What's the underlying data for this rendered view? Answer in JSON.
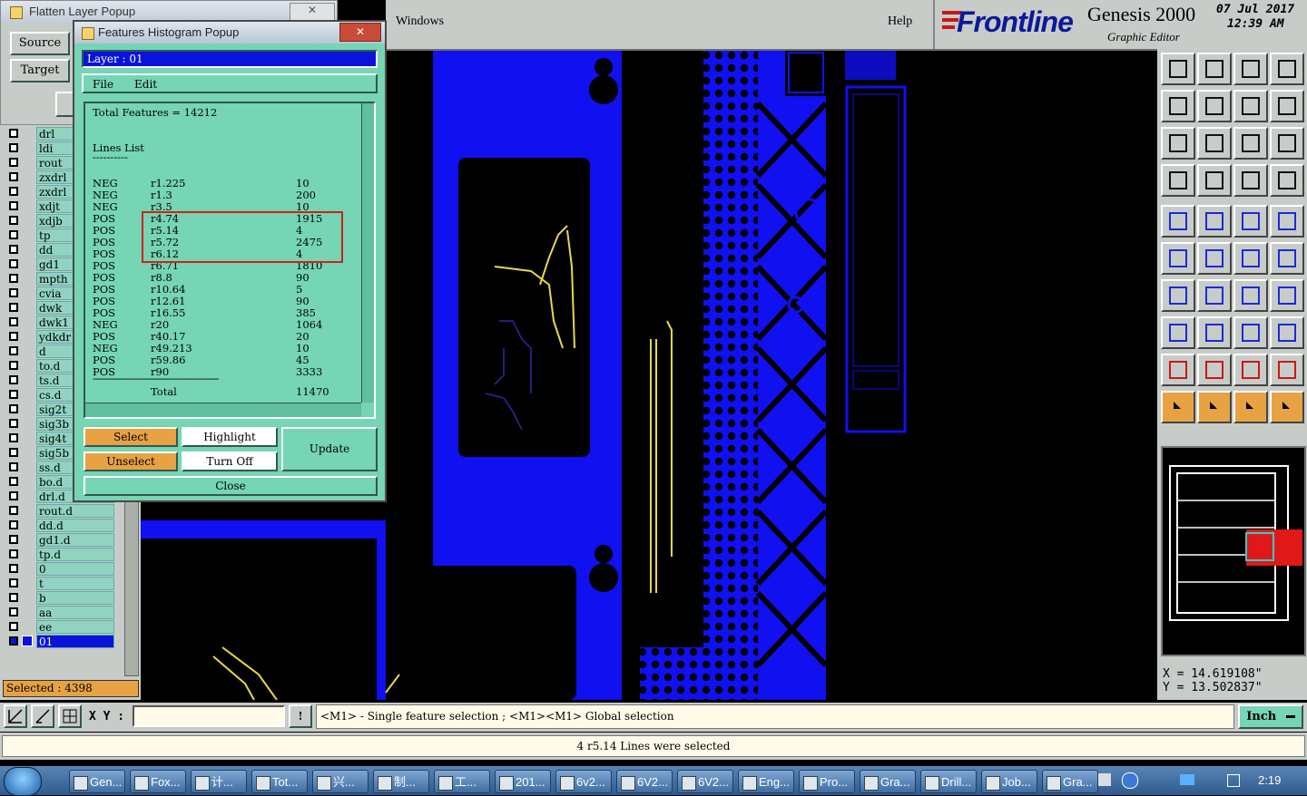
{
  "menubar": {
    "windows": "Windows",
    "help": "Help"
  },
  "brand": {
    "logo": "Frontline",
    "product": "Genesis 2000",
    "subtitle": "Graphic Editor",
    "date": "07 Jul 2017",
    "time": "12:39 AM"
  },
  "flatten_popup": {
    "title": "Flatten Layer Popup",
    "source_label": "Source",
    "target_label": "Target",
    "close_glyph": "✕"
  },
  "layers": [
    "drl",
    "ldi",
    "rout",
    "zxdrl",
    "zxdrl",
    "xdjt",
    "xdjb",
    "tp",
    "dd",
    "gd1",
    "mpth",
    "cvia",
    "dwk",
    "dwk1",
    "ydkdr",
    "d",
    "to.d",
    "ts.d",
    "cs.d",
    "sig2t",
    "sig3b",
    "sig4t",
    "sig5b",
    "ss.d",
    "bo.d",
    "drl.d",
    "rout.d",
    "dd.d",
    "gd1.d",
    "tp.d",
    "0",
    "t",
    "b",
    "aa",
    "ee",
    "01"
  ],
  "selected_count": "Selected : 4398",
  "histogram": {
    "title": "Features Histogram Popup",
    "close_glyph": "✕",
    "layer_label": "Layer :  01",
    "menu": [
      "File",
      "Edit"
    ],
    "total_features": "Total Features = 14212",
    "list_heading": "Lines List",
    "list_underline": "----------",
    "rows": [
      [
        "NEG",
        "r1.225",
        "10"
      ],
      [
        "NEG",
        "r1.3",
        "200"
      ],
      [
        "NEG",
        "r3.5",
        "10"
      ],
      [
        "POS",
        "r4.74",
        "1915"
      ],
      [
        "POS",
        "r5.14",
        "4"
      ],
      [
        "POS",
        "r5.72",
        "2475"
      ],
      [
        "POS",
        "r6.12",
        "4"
      ],
      [
        "POS",
        "r6.71",
        "1810"
      ],
      [
        "POS",
        "r8.8",
        "90"
      ],
      [
        "POS",
        "r10.64",
        "5"
      ],
      [
        "POS",
        "r12.61",
        "90"
      ],
      [
        "POS",
        "r16.55",
        "385"
      ],
      [
        "NEG",
        "r20",
        "1064"
      ],
      [
        "POS",
        "r40.17",
        "20"
      ],
      [
        "NEG",
        "r49.213",
        "10"
      ],
      [
        "POS",
        "r59.86",
        "45"
      ],
      [
        "POS",
        "r90",
        "3333"
      ]
    ],
    "separator": "------------------------------------------------",
    "total_label": "Total",
    "total_value": "11470",
    "buttons": {
      "select": "Select",
      "highlight": "Highlight",
      "update": "Update",
      "unselect": "Unselect",
      "turn_off": "Turn Off",
      "close": "Close"
    }
  },
  "coords": {
    "x": "X  =  14.619108\"",
    "y": "Y  =  13.502837\""
  },
  "xy_label": "X Y :",
  "xy_value": "",
  "hint": "<M1> - Single feature selection ; <M1><M1> Global selection",
  "units": "Inch",
  "status": "4 r5.14 Lines were selected",
  "taskbar": {
    "items": [
      "Gen...",
      "Fox...",
      "计...",
      "Tot...",
      "兴...",
      "制...",
      "工...",
      "201...",
      "6v2...",
      "6V2...",
      "6V2...",
      "Eng...",
      "Pro...",
      "Gra...",
      "Drill...",
      "Job...",
      "Gra..."
    ],
    "clock": "2:19"
  },
  "colors": {
    "canvas_blue": "#1010f0",
    "trace_yellow": "#e8d84a",
    "panel_green": "#75d5b4",
    "accent_orange": "#e7a244",
    "highlight_red": "#d02020"
  }
}
